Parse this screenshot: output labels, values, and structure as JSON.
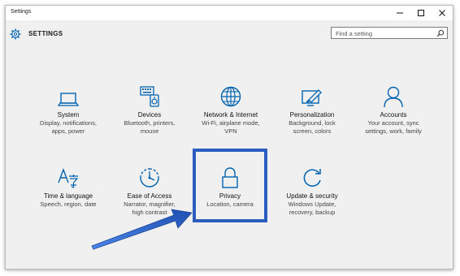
{
  "window": {
    "title": "Settings"
  },
  "header": {
    "title": "SETTINGS"
  },
  "search": {
    "placeholder": "Find a setting"
  },
  "tiles": [
    {
      "name": "System",
      "desc1": "Display, notifications,",
      "desc2": "apps, power",
      "desc3": "",
      "icon": "laptop-icon"
    },
    {
      "name": "Devices",
      "desc1": "Bluetooth, printers,",
      "desc2": "mouse",
      "desc3": "",
      "icon": "devices-icon"
    },
    {
      "name": "Network & Internet",
      "desc1": "Wi-Fi, airplane mode,",
      "desc2": "VPN",
      "desc3": "",
      "icon": "globe-icon"
    },
    {
      "name": "Personalization",
      "desc1": "Background, lock",
      "desc2": "screen, colors",
      "desc3": "",
      "icon": "paint-icon"
    },
    {
      "name": "Accounts",
      "desc1": "Your account, sync",
      "desc2": "settings, work, family",
      "desc3": "",
      "icon": "person-icon"
    },
    {
      "name": "Time & language",
      "desc1": "Speech, region, date",
      "desc2": "",
      "desc3": "",
      "icon": "language-icon"
    },
    {
      "name": "Ease of Access",
      "desc1": "Narrator, magnifier,",
      "desc2": "high contrast",
      "desc3": "",
      "icon": "ease-of-access-icon"
    },
    {
      "name": "Privacy",
      "desc1": "Location, camera",
      "desc2": "",
      "desc3": "",
      "icon": "lock-icon"
    },
    {
      "name": "Update & security",
      "desc1": "Windows Update,",
      "desc2": "recovery, backup",
      "desc3": "",
      "icon": "update-icon"
    }
  ],
  "colors": {
    "accent": "#0063b1",
    "highlight": "#2a5dbe"
  }
}
